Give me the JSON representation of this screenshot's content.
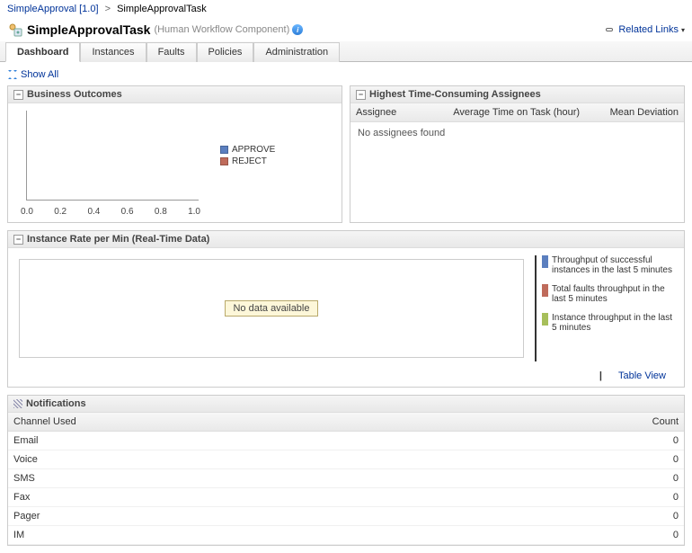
{
  "breadcrumb": {
    "parent": "SimpleApproval [1.0]",
    "separator": ">",
    "current": "SimpleApprovalTask"
  },
  "header": {
    "title": "SimpleApprovalTask",
    "subtitle": "(Human Workflow Component)",
    "related_links": "Related Links"
  },
  "tabs": [
    "Dashboard",
    "Instances",
    "Faults",
    "Policies",
    "Administration"
  ],
  "active_tab": 0,
  "show_all": "Show All",
  "biz_outcomes": {
    "title": "Business Outcomes",
    "legend": [
      {
        "label": "APPROVE",
        "color": "#5b7fbf"
      },
      {
        "label": "REJECT",
        "color": "#bf6b5b"
      }
    ]
  },
  "chart_data": {
    "type": "bar",
    "categories": [],
    "series": [
      {
        "name": "APPROVE",
        "values": []
      },
      {
        "name": "REJECT",
        "values": []
      }
    ],
    "xlim": [
      0.0,
      1.0
    ],
    "xticks": [
      "0.0",
      "0.2",
      "0.4",
      "0.6",
      "0.8",
      "1.0"
    ]
  },
  "assignees": {
    "title": "Highest Time-Consuming Assignees",
    "columns": [
      "Assignee",
      "Average Time on Task (hour)",
      "Mean Deviation"
    ],
    "empty": "No assignees found"
  },
  "instance_rate": {
    "title": "Instance Rate per Min (Real-Time Data)",
    "no_data": "No data available",
    "table_view": "Table View",
    "legend": [
      {
        "label": "Throughput of successful instances in the last 5 minutes",
        "color": "#5b7fbf"
      },
      {
        "label": "Total faults throughput in the last 5 minutes",
        "color": "#bf6b5b"
      },
      {
        "label": "Instance throughput in the last 5 minutes",
        "color": "#a7bf5b"
      }
    ]
  },
  "notifications": {
    "title": "Notifications",
    "columns": [
      "Channel Used",
      "Count"
    ],
    "rows": [
      {
        "channel": "Email",
        "count": 0
      },
      {
        "channel": "Voice",
        "count": 0
      },
      {
        "channel": "SMS",
        "count": 0
      },
      {
        "channel": "Fax",
        "count": 0
      },
      {
        "channel": "Pager",
        "count": 0
      },
      {
        "channel": "IM",
        "count": 0
      }
    ]
  }
}
